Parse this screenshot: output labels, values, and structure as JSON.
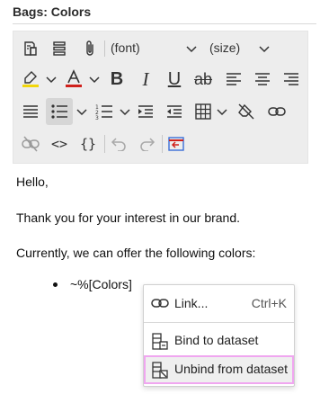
{
  "header": {
    "title": "Bags: Colors"
  },
  "toolbar": {
    "font_select": "(font)",
    "size_select": "(size)",
    "buttons": {
      "bold": "B",
      "italic": "I",
      "underline": "U",
      "strikethrough": "ab",
      "source": "<>",
      "braces": "{}"
    },
    "highlight_color": "#f2d60a",
    "font_color": "#d0211c",
    "active_tool": "bulleted-list"
  },
  "content": {
    "greeting": "Hello,",
    "line2": "Thank you for your interest in our brand.",
    "line3": "Currently, we can offer the following colors:",
    "bullet": "~%[Colors]"
  },
  "context_menu": {
    "items": [
      {
        "label": "Link...",
        "shortcut": "Ctrl+K",
        "icon": "link-icon"
      },
      {
        "label": "Bind to dataset",
        "icon": "dataset-icon"
      },
      {
        "label": "Unbind from dataset",
        "icon": "dataset-unbind-icon",
        "highlighted": true
      }
    ]
  }
}
